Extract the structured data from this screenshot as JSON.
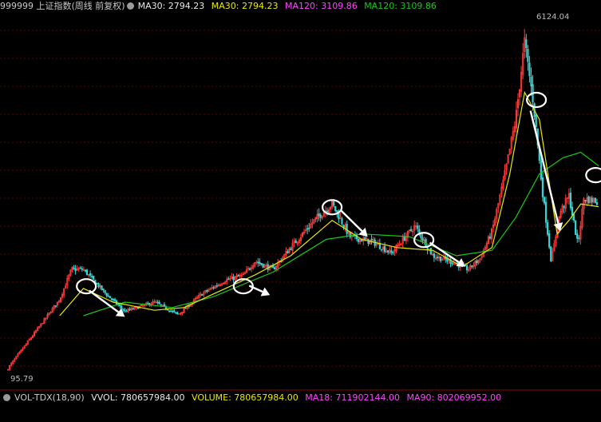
{
  "header": {
    "symbol": "999999 上证指数(周线 前复权)",
    "ma30_a": "MA30: 2794.23",
    "ma30_b": "MA30: 2794.23",
    "ma120_a": "MA120: 3109.86",
    "ma120_b": "MA120: 3109.86"
  },
  "footer": {
    "indicator": "VOL-TDX(18,90)",
    "vvol": "VVOL: 780657984.00",
    "volume": "VOLUME: 780657984.00",
    "ma18": "MA18: 711902144.00",
    "ma90": "MA90: 802069952.00"
  },
  "colors": {
    "background": "#000000",
    "up": "#ff3b3b",
    "down": "#35d6d6",
    "ma30": "#e8e800",
    "ma120": "#19c919",
    "ma_short": "#ff66ff",
    "annotation": "#ffffff",
    "grid": "#5a0000"
  },
  "chart_data": {
    "type": "candlestick",
    "title": "",
    "y_labels": {
      "high": "6124.04",
      "low": "95.79"
    },
    "price_path": [
      [
        0.0,
        95.79
      ],
      [
        0.09,
        1400
      ],
      [
        0.11,
        1950
      ],
      [
        0.13,
        1950
      ],
      [
        0.17,
        1480
      ],
      [
        0.2,
        1180
      ],
      [
        0.25,
        1350
      ],
      [
        0.29,
        1120
      ],
      [
        0.33,
        1500
      ],
      [
        0.37,
        1750
      ],
      [
        0.4,
        1840
      ],
      [
        0.42,
        2100
      ],
      [
        0.45,
        1950
      ],
      [
        0.48,
        2350
      ],
      [
        0.52,
        2850
      ],
      [
        0.55,
        3150
      ],
      [
        0.58,
        2550
      ],
      [
        0.62,
        2450
      ],
      [
        0.65,
        2250
      ],
      [
        0.69,
        2750
      ],
      [
        0.72,
        2200
      ],
      [
        0.75,
        2100
      ],
      [
        0.78,
        1950
      ],
      [
        0.8,
        2150
      ],
      [
        0.82,
        2650
      ],
      [
        0.84,
        3600
      ],
      [
        0.86,
        4700
      ],
      [
        0.875,
        6124.04
      ],
      [
        0.89,
        5000
      ],
      [
        0.905,
        3400
      ],
      [
        0.92,
        2100
      ],
      [
        0.935,
        3000
      ],
      [
        0.95,
        3300
      ],
      [
        0.965,
        2400
      ],
      [
        0.975,
        3250
      ],
      [
        1.0,
        3200
      ]
    ],
    "ma30_path": [
      [
        0.09,
        1100
      ],
      [
        0.13,
        1600
      ],
      [
        0.18,
        1350
      ],
      [
        0.25,
        1200
      ],
      [
        0.3,
        1250
      ],
      [
        0.35,
        1500
      ],
      [
        0.42,
        1850
      ],
      [
        0.48,
        2200
      ],
      [
        0.55,
        2850
      ],
      [
        0.6,
        2500
      ],
      [
        0.66,
        2350
      ],
      [
        0.72,
        2300
      ],
      [
        0.77,
        2000
      ],
      [
        0.82,
        2350
      ],
      [
        0.85,
        3700
      ],
      [
        0.875,
        5200
      ],
      [
        0.9,
        4700
      ],
      [
        0.93,
        2600
      ],
      [
        0.95,
        2850
      ],
      [
        0.97,
        3150
      ],
      [
        1.0,
        3100
      ]
    ],
    "ma120_path": [
      [
        0.13,
        1100
      ],
      [
        0.2,
        1350
      ],
      [
        0.28,
        1250
      ],
      [
        0.35,
        1450
      ],
      [
        0.45,
        1900
      ],
      [
        0.54,
        2500
      ],
      [
        0.6,
        2600
      ],
      [
        0.68,
        2550
      ],
      [
        0.76,
        2200
      ],
      [
        0.82,
        2300
      ],
      [
        0.86,
        2900
      ],
      [
        0.9,
        3700
      ],
      [
        0.94,
        4000
      ],
      [
        0.97,
        4100
      ],
      [
        1.0,
        3850
      ]
    ],
    "annotations": {
      "circles": [
        [
          0.135,
          1640
        ],
        [
          0.4,
          1640
        ],
        [
          0.55,
          3090
        ],
        [
          0.705,
          2490
        ],
        [
          0.895,
          5060
        ],
        [
          0.995,
          3680
        ]
      ],
      "arrows": [
        [
          [
            0.14,
            1560
          ],
          [
            0.2,
            1080
          ]
        ],
        [
          [
            0.41,
            1650
          ],
          [
            0.445,
            1480
          ]
        ],
        [
          [
            0.565,
            3030
          ],
          [
            0.61,
            2550
          ]
        ],
        [
          [
            0.715,
            2440
          ],
          [
            0.775,
            2000
          ]
        ],
        [
          [
            0.885,
            4860
          ],
          [
            0.935,
            2650
          ]
        ]
      ]
    },
    "ylim": [
      0,
      6600
    ],
    "xlabel": "",
    "ylabel": ""
  }
}
